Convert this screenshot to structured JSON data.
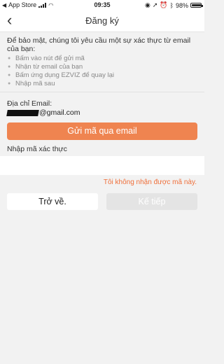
{
  "status_bar": {
    "carrier": "App Store",
    "time": "09:35",
    "battery": "98%",
    "battery_level": 0.98
  },
  "nav": {
    "back_icon": "chevron-left-icon",
    "title": "Đăng ký"
  },
  "info": {
    "intro": "Để bảo mật, chúng tôi yêu cầu một sự xác thực từ email của bạn:",
    "steps": [
      "Bấm vào nút để gửi mã",
      "Nhận từ email của bạn",
      "Bấm ứng dụng EZVIZ để quay lại",
      "Nhập mã sau"
    ]
  },
  "email": {
    "label": "Địa chỉ Email:",
    "value_suffix": "@gmail.com"
  },
  "send_button": "Gửi mã qua email",
  "code": {
    "label": "Nhập mã xác thực",
    "value": "",
    "placeholder": ""
  },
  "no_code_link": "Tôi không nhận được mã này.",
  "buttons": {
    "back": "Trở về.",
    "next": "Kế tiếp"
  },
  "colors": {
    "accent": "#ef8450",
    "link": "#ef6f3a",
    "disabled": "#e4e4e4"
  }
}
